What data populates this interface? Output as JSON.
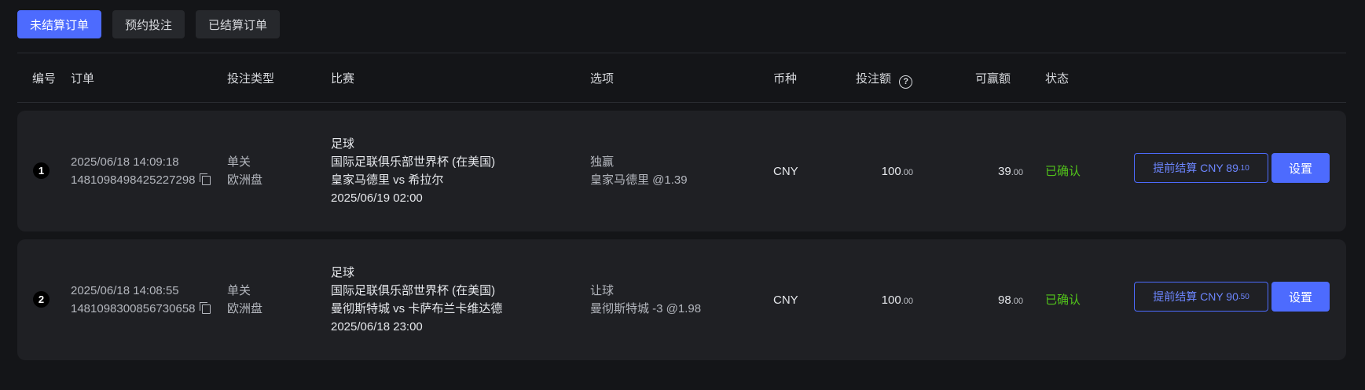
{
  "tabs": [
    {
      "label": "未结算订单",
      "active": true
    },
    {
      "label": "预约投注",
      "active": false
    },
    {
      "label": "已结算订单",
      "active": false
    }
  ],
  "columns": {
    "index": "编号",
    "order": "订单",
    "bet_type": "投注类型",
    "match": "比赛",
    "option": "选项",
    "currency": "币种",
    "stake": "投注额",
    "payout": "可赢额",
    "status": "状态"
  },
  "rows": [
    {
      "index": "1",
      "time": "2025/06/18 14:09:18",
      "order_id": "1481098498425227298",
      "bet_type": "单关",
      "odds_type": "欧洲盘",
      "sport": "足球",
      "league": "国际足联俱乐部世界杯 (在美国)",
      "teams": "皇家马德里 vs 希拉尔",
      "match_time": "2025/06/19 02:00",
      "market": "独赢",
      "selection": "皇家马德里  @1.39",
      "currency": "CNY",
      "stake_int": "100",
      "stake_dec": ".00",
      "payout_int": "39",
      "payout_dec": ".00",
      "status": "已确认",
      "early_label": "提前结算 CNY  89",
      "early_dec": ".10",
      "set_label": "设置"
    },
    {
      "index": "2",
      "time": "2025/06/18 14:08:55",
      "order_id": "1481098300856730658",
      "bet_type": "单关",
      "odds_type": "欧洲盘",
      "sport": "足球",
      "league": "国际足联俱乐部世界杯 (在美国)",
      "teams": "曼彻斯特城 vs 卡萨布兰卡维达德",
      "match_time": "2025/06/18 23:00",
      "market": "让球",
      "selection": "曼彻斯特城 -3  @1.98",
      "currency": "CNY",
      "stake_int": "100",
      "stake_dec": ".00",
      "payout_int": "98",
      "payout_dec": ".00",
      "status": "已确认",
      "early_label": "提前结算 CNY  90",
      "early_dec": ".50",
      "set_label": "设置"
    }
  ],
  "colors": {
    "accent": "#4d6bfe",
    "status_ok": "#52c41a",
    "background": "#141518",
    "card": "#1f2024"
  },
  "icons": {
    "help": "question-circle-icon",
    "copy": "copy-icon"
  }
}
